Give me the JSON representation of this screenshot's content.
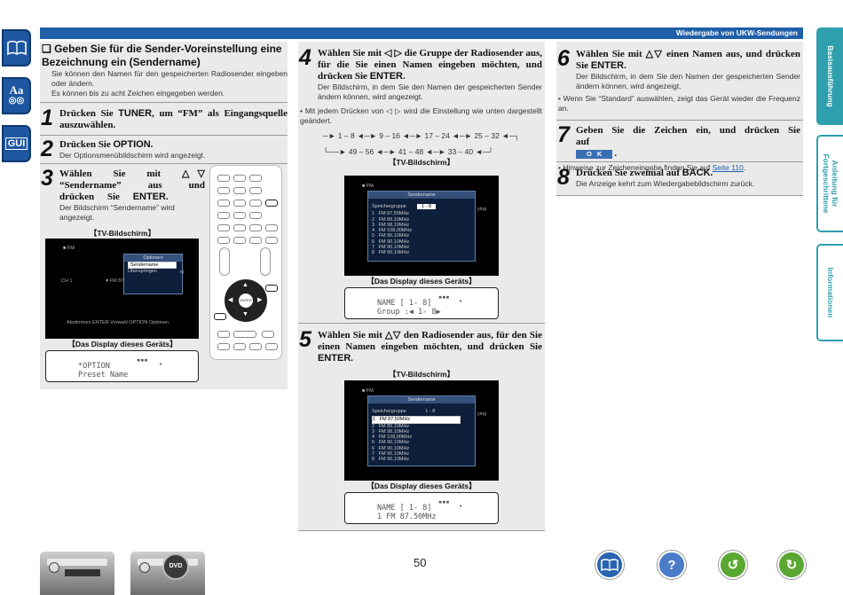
{
  "header": {
    "section": "Wiedergabe von UKW-Sendungen"
  },
  "side_icons": [
    {
      "name": "book-icon",
      "glyph": "📖"
    },
    {
      "name": "font-icon",
      "glyph": "Aa"
    },
    {
      "name": "gui-icon",
      "glyph": "GUI"
    }
  ],
  "tabs": [
    {
      "label": "Basisausführung",
      "active": true
    },
    {
      "label": "Anleitung für\nFortgeschrittene",
      "active": false
    },
    {
      "label": "Informationen",
      "active": false
    }
  ],
  "col1": {
    "title": "❏ Geben Sie für die Sender-Voreinstellung eine Bezeichnung ein (Sendername)",
    "intro1": "Sie können den Namen für den gespeicherten Radiosender eingeben oder ändern.",
    "intro2": "Es können bis zu acht Zeichen eingegeben werden.",
    "step1": {
      "num": "1",
      "text_pre": "Drücken Sie ",
      "key": "TUNER",
      "text_post": ", um “FM” als Eingangsquelle auszuwählen."
    },
    "step2": {
      "num": "2",
      "text_pre": "Drücken Sie ",
      "key": "OPTION",
      "text_post": ".",
      "note": "Der Optionsmenübildschirm wird angezeigt."
    },
    "step3": {
      "num": "3",
      "text_pre": "Wählen Sie mit △▽ “Sendername” aus und drücken Sie ",
      "key": "ENTER",
      "text_post": ".",
      "note": "Der Bildschirm “Sendername” wird angezeigt."
    },
    "tv_label": "【TV-Bildschirm】",
    "tv": {
      "fm": "FM",
      "menu_title": "Optionen",
      "items": [
        "Sendername",
        "Überspringen"
      ],
      "ch": "CH 1",
      "freq": "FM 87",
      "footer": "Abstimmen ENTER Vorwahl OPTION Optionen"
    },
    "display_label": "【Das Display dieses Geräts】",
    "display": {
      "line1": "*OPTION",
      "line2": "Preset Name"
    }
  },
  "col2": {
    "step4": {
      "num": "4",
      "text_pre": "Wählen Sie mit ◁ ▷ die Gruppe der Radiosender aus, für die Sie einen Namen eingeben möchten, und drücken Sie ",
      "key": "ENTER",
      "text_post": ".",
      "note": "Der Bildschirm, in dem Sie den Namen der gespeicherten Sender ändern können, wird angezeigt."
    },
    "bullet": "Mit jedem Drücken von ◁ ▷ wird die Einstellung wie unten dargestellt geändert.",
    "cycle_row1": [
      "1 – 8",
      "9 – 16",
      "17 – 24",
      "25 – 32"
    ],
    "cycle_row2": [
      "49 – 56",
      "41 – 48",
      "33 – 40"
    ],
    "tv_label": "【TV-Bildschirm】",
    "tv1": {
      "fm": "FM",
      "menu_title": "Sendername",
      "group_label": "Speichergruppe",
      "group_value": "1 - 8",
      "right": "ying",
      "stations": [
        "1   FM 87,50MHz",
        "2   FM 89,10MHz",
        "3   FM 98,10MHz",
        "4   FM 108,00MHz",
        "5   FM 90,10MHz",
        "6   FM 90,10MHz",
        "7   FM 90,10MHz",
        "8   FM 90,10MHz"
      ]
    },
    "display_label": "【Das Display dieses Geräts】",
    "display1": {
      "line1": "NAME [ 1- 8]",
      "line2": "Group   :◀ 1- 8▶"
    },
    "step5": {
      "num": "5",
      "text_pre": "Wählen Sie mit △▽ den Radiosender aus, für den Sie einen Namen eingeben möchten, und drücken Sie ",
      "key": "ENTER",
      "text_post": "."
    },
    "tv2": {
      "fm": "FM",
      "menu_title": "Sendername",
      "group_label": "Speichergruppe",
      "group_value": "1 - 8",
      "right": "ying",
      "stations": [
        "1   FM 87,50MHz",
        "2   FM 89,10MHz",
        "3   FM 98,10MHz",
        "4   FM 108,00MHz",
        "5   FM 90,10MHz",
        "6   FM 90,10MHz",
        "7   FM 90,10MHz",
        "8   FM 90,10MHz"
      ]
    },
    "display2": {
      "line1": "NAME [ 1- 8]",
      "line2": "1 FM  87.50MHz"
    }
  },
  "col3": {
    "step6": {
      "num": "6",
      "text_pre": "Wählen Sie mit △▽ einen Namen aus, und drücken Sie ",
      "key": "ENTER",
      "text_post": ".",
      "note": "Der Bildschirm, in dem Sie den Namen der gespeicherten Sender ändern können, wird angezeigt."
    },
    "bullet6": "Wenn Sie “Standard” auswählen, zeigt das Gerät wieder die Frequenz an.",
    "step7": {
      "num": "7",
      "text": "Geben Sie die Zeichen ein, und drücken Sie auf",
      "ok": "O K"
    },
    "bullet7_pre": "Hinweise zur Zeicheneingabe finden Sie auf ",
    "bullet7_link": "Seite 110",
    "bullet7_post": ".",
    "step8": {
      "num": "8",
      "text_pre": "Drücken Sie zweimal auf ",
      "key": "BACK",
      "text_post": ".",
      "note": "Die Anzeige kehrt zum Wiedergabebildschirm zurück."
    }
  },
  "footer": {
    "page": "50",
    "nav_icons": [
      "book-icon",
      "help-icon",
      "back-icon",
      "forward-icon"
    ],
    "badge": "DVD"
  }
}
